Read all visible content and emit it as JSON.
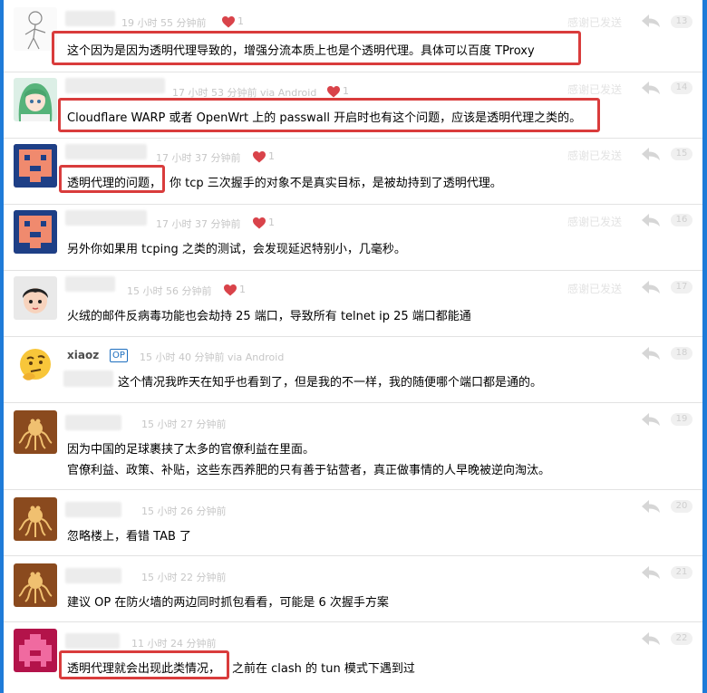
{
  "replies": [
    {
      "time": "19 小时 55 分钟前",
      "hearts": "1",
      "thank_label": "感谢已发送",
      "floor": "13",
      "content": "这个因为是因为透明代理导致的，增强分流本质上也是个透明代理。具体可以百度 TProxy",
      "avatar_icon": "sketch-figure-avatar"
    },
    {
      "time": "17 小时 53 分钟前 via Android",
      "hearts": "1",
      "thank_label": "感谢已发送",
      "floor": "14",
      "content": "Cloudflare WARP 或者 OpenWrt 上的 passwall 开启时也有这个问题，应该是透明代理之类的。",
      "avatar_icon": "anime-girl-avatar"
    },
    {
      "time": "17 小时 37 分钟前",
      "hearts": "1",
      "thank_label": "感谢已发送",
      "floor": "15",
      "content_highlight": "透明代理的问题，",
      "content_rest": "你 tcp 三次握手的对象不是真实目标，是被劫持到了透明代理。",
      "avatar_icon": "pixel-invader-avatar"
    },
    {
      "time": "17 小时 37 分钟前",
      "hearts": "1",
      "thank_label": "感谢已发送",
      "floor": "16",
      "content": "另外你如果用 tcping 之类的测试，会发现延迟特别小，几毫秒。",
      "avatar_icon": "pixel-invader-avatar"
    },
    {
      "time": "15 小时 56 分钟前",
      "hearts": "1",
      "thank_label": "感谢已发送",
      "floor": "17",
      "content": "火绒的邮件反病毒功能也会劫持 25 端口，导致所有 telnet ip 25 端口都能通",
      "avatar_icon": "cartoon-boy-avatar"
    },
    {
      "username": "xiaoz",
      "op_badge": "OP",
      "time": "15 小时 40 分钟前 via Android",
      "floor": "18",
      "content": "这个情况我昨天在知乎也看到了，但是我的不一样，我的随便哪个端口都是通的。",
      "avatar_icon": "thinking-emoji-avatar"
    },
    {
      "time": "15 小时 27 分钟前",
      "floor": "19",
      "content": "因为中国的足球裹挟了太多的官僚利益在里面。",
      "content_line2": "官僚利益、政策、补贴，这些东西养肥的只有善于钻营者，真正做事情的人早晚被逆向淘汰。",
      "avatar_icon": "spaghetti-monster-avatar"
    },
    {
      "time": "15 小时 26 分钟前",
      "floor": "20",
      "content": "忽略楼上，看错 TAB 了",
      "avatar_icon": "spaghetti-monster-avatar"
    },
    {
      "time": "15 小时 22 分钟前",
      "floor": "21",
      "content": "建议 OP 在防火墙的两边同时抓包看看，可能是 6 次握手方案",
      "avatar_icon": "spaghetti-monster-avatar"
    },
    {
      "time": "11 小时 24 分钟前",
      "floor": "22",
      "content_highlight": "透明代理就会出现此类情况，",
      "content_rest": "之前在 clash 的 tun 模式下遇到过",
      "avatar_icon": "pink-pixel-avatar"
    }
  ],
  "colors": {
    "frame": "#1e7bd8",
    "highlight_box": "#d93c3c",
    "heart": "#d9434a",
    "meta_text": "#c6c6c6"
  }
}
